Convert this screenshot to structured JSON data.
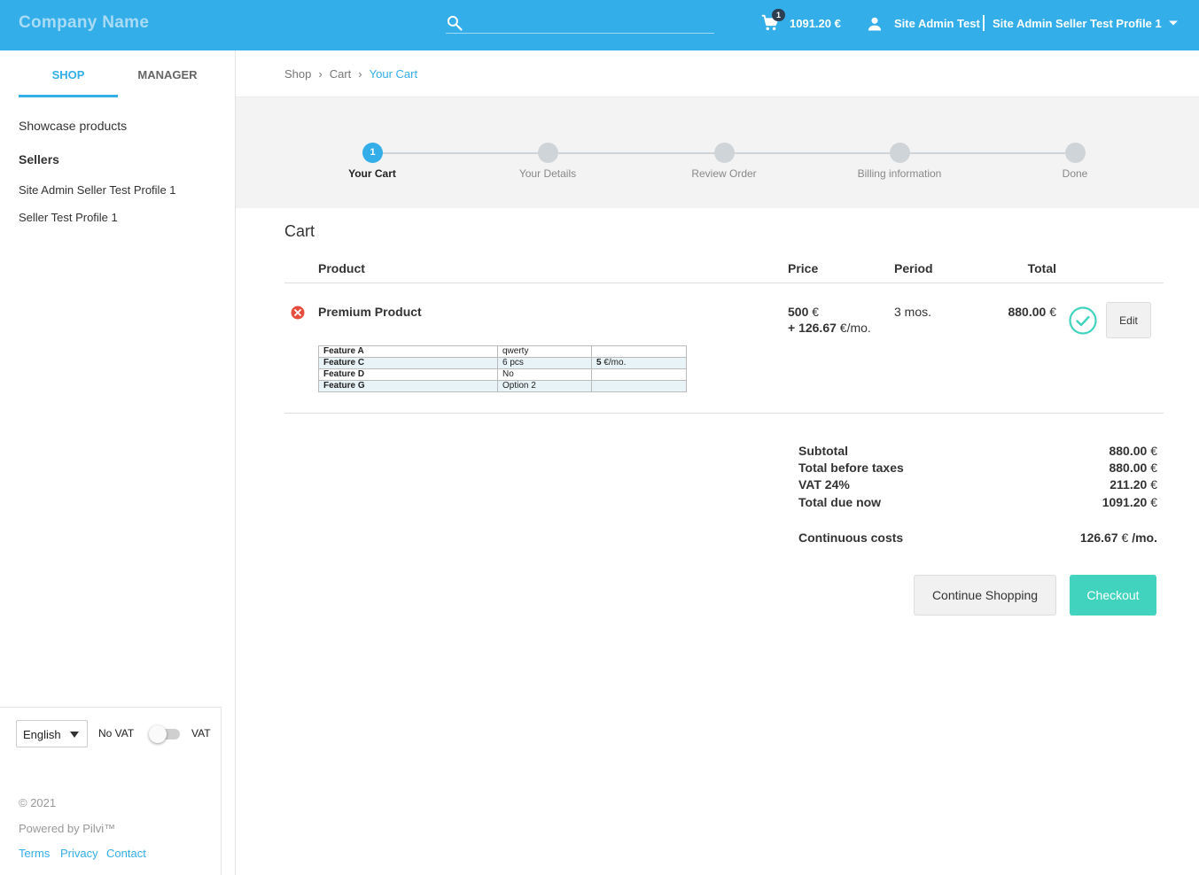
{
  "header": {
    "brand": "Company Name",
    "cart_count": "1",
    "cart_total": "1091.20 €",
    "user_name": "Site Admin Test",
    "profile_name": "Site Admin Seller Test Profile 1",
    "icons": [
      "search-icon",
      "cart-icon",
      "user-icon",
      "chevron-down-icon"
    ],
    "colors": {
      "primary": "#33aee8",
      "accent": "#41d3bd",
      "danger": "#e74c3c"
    }
  },
  "sidebar": {
    "tabs": [
      {
        "label": "SHOP",
        "active": true
      },
      {
        "label": "MANAGER",
        "active": false
      }
    ],
    "showcase": "Showcase products",
    "sellers_heading": "Sellers",
    "sellers": [
      "Site Admin Seller Test Profile 1",
      "Seller Test Profile 1"
    ],
    "footer": {
      "language": "English",
      "no_vat": "No VAT",
      "vat": "VAT",
      "copyright": "© 2021",
      "powered": "Powered by Pilvi™",
      "links": [
        "Terms",
        "Privacy",
        "Contact"
      ]
    }
  },
  "breadcrumb": [
    "Shop",
    "Cart",
    "Your Cart"
  ],
  "steps": [
    {
      "number": "1",
      "label": "Your Cart",
      "active": true
    },
    {
      "number": "",
      "label": "Your Details",
      "active": false
    },
    {
      "number": "",
      "label": "Review Order",
      "active": false
    },
    {
      "number": "",
      "label": "Billing information",
      "active": false
    },
    {
      "number": "",
      "label": "Done",
      "active": false
    }
  ],
  "cart": {
    "title": "Cart",
    "columns": {
      "product": "Product",
      "price": "Price",
      "period": "Period",
      "total": "Total"
    },
    "item": {
      "name": "Premium Product",
      "price_amount": "500",
      "price_currency": " €",
      "recurring_amount": "+ 126.67",
      "recurring_unit": " €/mo.",
      "period": "3 mos.",
      "total_amount": "880.00",
      "total_currency": " €",
      "edit_label": "Edit",
      "features": [
        {
          "name": "Feature A",
          "value": "qwerty",
          "extra_amount": "",
          "extra_unit": ""
        },
        {
          "name": "Feature C",
          "value": "6 pcs",
          "extra_amount": "5",
          "extra_unit": " €/mo."
        },
        {
          "name": "Feature D",
          "value": "No",
          "extra_amount": "",
          "extra_unit": ""
        },
        {
          "name": "Feature G",
          "value": "Option 2",
          "extra_amount": "",
          "extra_unit": ""
        }
      ]
    },
    "summary": [
      {
        "label": "Subtotal",
        "amount": "880.00",
        "unit": " €"
      },
      {
        "label": "Total before taxes",
        "amount": "880.00",
        "unit": " €"
      },
      {
        "label": "VAT 24%",
        "amount": "211.20",
        "unit": " €"
      },
      {
        "label": "Total due now",
        "amount": "1091.20",
        "unit": " €"
      }
    ],
    "continuous": {
      "label": "Continuous costs",
      "amount": "126.67",
      "unit": " €",
      "suffix": " /mo."
    },
    "continue_label": "Continue Shopping",
    "checkout_label": "Checkout"
  }
}
